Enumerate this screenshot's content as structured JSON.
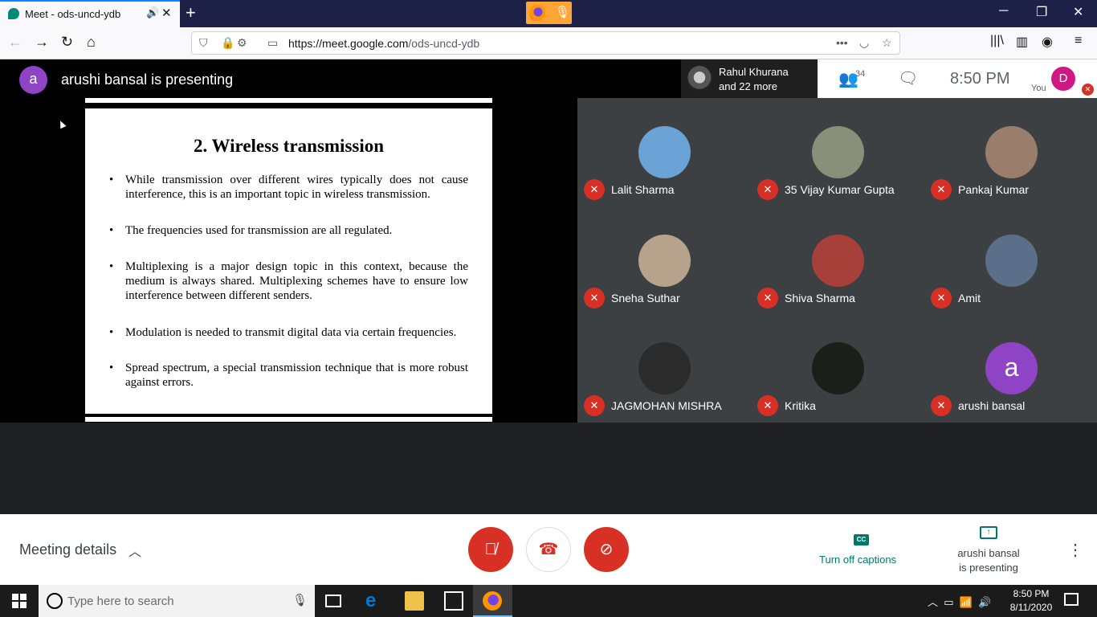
{
  "browser": {
    "tab_title": "Meet - ods-uncd-ydb",
    "url_host": "https://meet.google.com",
    "url_path": "/ods-uncd-ydb"
  },
  "meet": {
    "presenting_title": "arushi bansal is presenting",
    "presenter_initial": "a",
    "others_line1": "Rahul Khurana",
    "others_line2": "and 22 more",
    "participant_count": "34",
    "clock": "8:50  PM",
    "you_label": "You",
    "self_initial": "D"
  },
  "slide": {
    "title": "2. Wireless transmission",
    "bullets": [
      "While transmission over different wires typically does not cause interference, this is an important topic in wireless transmission.",
      "The frequencies used for transmission are all regulated.",
      "Multiplexing is a major design topic in this context, because the medium is always shared. Multiplexing schemes have to ensure low interference between different senders.",
      "Modulation is needed to transmit digital data via certain frequencies.",
      "Spread spectrum, a special transmission technique that is more robust against errors."
    ]
  },
  "participants": [
    {
      "name": "Lalit Sharma",
      "color": "#6ba3d6"
    },
    {
      "name": "35 Vijay Kumar Gupta",
      "color": "#8a8f7a"
    },
    {
      "name": "Pankaj Kumar",
      "color": "#9a7d6a"
    },
    {
      "name": "Sneha Suthar",
      "color": "#b7a38b"
    },
    {
      "name": "Shiva Sharma",
      "color": "#a8403a"
    },
    {
      "name": "Amit",
      "color": "#5b6f8a"
    },
    {
      "name": "JAGMOHAN MISHRA",
      "color": "#2b2b2b"
    },
    {
      "name": "Kritika",
      "color": "#1a1f1a"
    },
    {
      "name": "arushi bansal",
      "color": "#8e44c4",
      "initial": "a"
    }
  ],
  "controls": {
    "meeting_details": "Meeting details",
    "captions_label": "Turn off captions",
    "cc_text": "CC",
    "present_line1": "arushi bansal",
    "present_line2": "is presenting"
  },
  "taskbar": {
    "search_placeholder": "Type here to search",
    "time": "8:50 PM",
    "date": "8/11/2020"
  },
  "colors": {
    "accent_red": "#d93025",
    "meet_teal": "#00796b"
  }
}
